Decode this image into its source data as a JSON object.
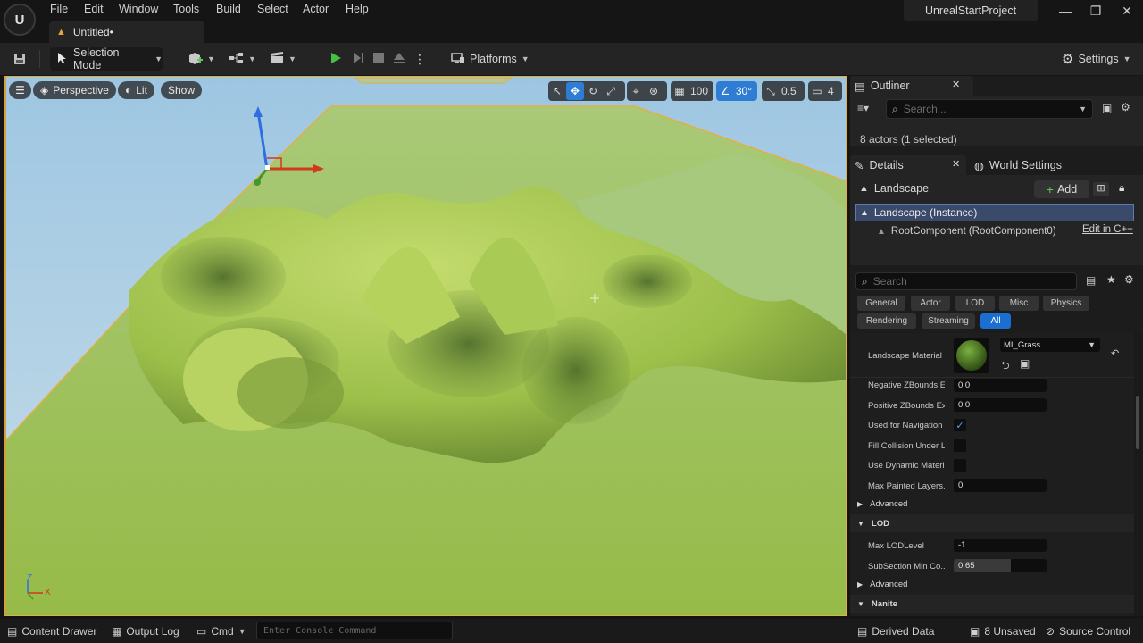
{
  "app": {
    "logo_text": "U",
    "project_name": "UnrealStartProject"
  },
  "menu": [
    "File",
    "Edit",
    "Window",
    "Tools",
    "Build",
    "Select",
    "Actor",
    "Help"
  ],
  "document_tab": {
    "title": "Untitled•"
  },
  "window_controls": {
    "minimize": "—",
    "maximize": "❐",
    "close": "✕"
  },
  "toolbar": {
    "mode_label": "Selection Mode",
    "platforms_label": "Platforms",
    "settings_label": "Settings"
  },
  "viewport": {
    "perspective_label": "Perspective",
    "lit_label": "Lit",
    "show_label": "Show",
    "grid_snap_value": "100",
    "rotation_snap_value": "30°",
    "scale_snap_value": "0.5",
    "camera_speed_value": "4",
    "axis_z": "Z",
    "axis_x": "X"
  },
  "outliner": {
    "title": "Outliner",
    "search_placeholder": "Search...",
    "actor_count": "8 actors (1 selected)"
  },
  "details": {
    "tab_details": "Details",
    "tab_world_settings": "World Settings",
    "actor_name": "Landscape",
    "add_label": "Add",
    "instance_label": "Landscape (Instance)",
    "root_component": "RootComponent (RootComponent0)",
    "edit_cpp": "Edit in C++",
    "search_placeholder": "Search",
    "filters": [
      "General",
      "Actor",
      "LOD",
      "Misc",
      "Physics",
      "Rendering",
      "Streaming",
      "All"
    ],
    "active_filter": "All",
    "landscape_material_label": "Landscape Material",
    "material_value": "MI_Grass",
    "props": [
      {
        "label": "Negative ZBounds E...",
        "value": "0.0"
      },
      {
        "label": "Positive ZBounds Ex...",
        "value": "0.0"
      },
      {
        "label": "Used for Navigation",
        "checked": true
      },
      {
        "label": "Fill Collision Under L...",
        "checked": false
      },
      {
        "label": "Use Dynamic Materi...",
        "checked": false
      },
      {
        "label": "Max Painted Layers...",
        "value": "0"
      }
    ],
    "advanced_label": "Advanced",
    "lod_section": "LOD",
    "max_lod_label": "Max LODLevel",
    "max_lod_value": "-1",
    "subsection_label": "SubSection Min Co...",
    "subsection_value": "0.65",
    "subsection_fill": 0.62,
    "advanced2_label": "Advanced",
    "nanite_section": "Nanite"
  },
  "statusbar": {
    "content_drawer": "Content Drawer",
    "output_log": "Output Log",
    "cmd": "Cmd",
    "console_placeholder": "Enter Console Command",
    "derived_data": "Derived Data",
    "unsaved": "8 Unsaved",
    "source_control": "Source Control"
  },
  "colors": {
    "accent": "#2f7dd3",
    "selection_border": "#e0b040",
    "grass": "#9fc45a",
    "sky": "#a8cbe0"
  }
}
